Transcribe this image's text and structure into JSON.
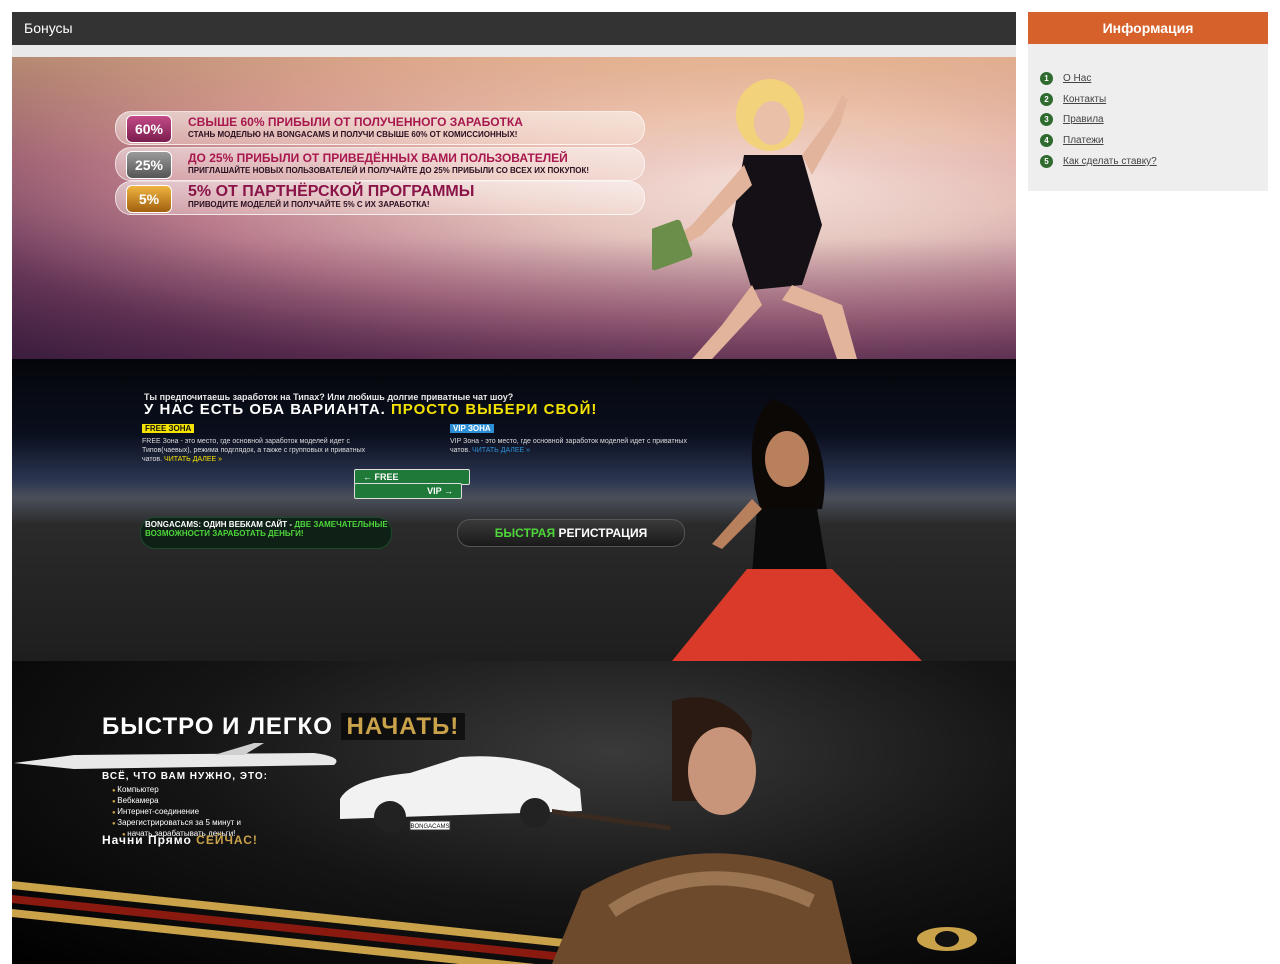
{
  "main": {
    "title": "Бонусы"
  },
  "banner1": {
    "rows": [
      {
        "badge": "60%",
        "title": "СВЫШЕ 60% ПРИБЫЛИ ОТ ПОЛУЧЕННОГО ЗАРАБОТКА",
        "sub": "СТАНЬ МОДЕЛЬЮ НА BONGACAMS И ПОЛУЧИ СВЫШЕ 60% ОТ КОМИССИОННЫХ!"
      },
      {
        "badge": "25%",
        "title": "ДО 25% ПРИБЫЛИ ОТ ПРИВЕДЁННЫХ ВАМИ ПОЛЬЗОВАТЕЛЕЙ",
        "sub": "ПРИГЛАШАЙТЕ НОВЫХ ПОЛЬЗОВАТЕЛЕЙ И ПОЛУЧАЙТЕ ДО 25% ПРИБЫЛИ СО ВСЕХ ИХ ПОКУПОК!"
      },
      {
        "badge": "5%",
        "title": "5% ОТ ПАРТНЁРСКОЙ ПРОГРАММЫ",
        "sub": "ПРИВОДИТЕ МОДЕЛЕЙ И ПОЛУЧАЙТЕ 5% С ИХ ЗАРАБОТКА!"
      }
    ]
  },
  "banner2": {
    "question": "Ты предпочитаешь заработок на Типах? Или любишь долгие приватные чат шоу?",
    "headline_part1": "У НАС ЕСТЬ ОБА ВАРИАНТА.",
    "headline_part2": "ПРОСТО ВЫБЕРИ СВОЙ!",
    "free_label": "FREE ЗОНА",
    "free_text": "FREE Зона - это место, где основной заработок моделей идет с Типов(чаевых), режима подглядок, а также с групповых и приватных чатов.",
    "free_link": "ЧИТАТЬ ДАЛЕЕ »",
    "vip_label": "VIP ЗОНА",
    "vip_text": "VIP Зона - это место, где основной заработок моделей идет с приватных чатов.",
    "vip_link": "ЧИТАТЬ ДАЛЕЕ »",
    "sign_free": "← FREE",
    "sign_vip": "VIP →",
    "slogan_white": "BONGACAMS: ОДИН ВЕБКАМ САЙТ -",
    "slogan_green": "ДВЕ ЗАМЕЧАТЕЛЬНЫЕ ВОЗМОЖНОСТИ ЗАРАБОТАТЬ ДЕНЬГИ!",
    "register_green": "БЫСТРАЯ",
    "register_white": "РЕГИСТРАЦИЯ"
  },
  "banner3": {
    "headline_white": "БЫСТРО И ЛЕГКО",
    "headline_gold": "НАЧАТЬ!",
    "need_title": "ВСЁ, ЧТО ВАМ НУЖНО, ЭТО:",
    "need_items": [
      "Компьютер",
      "Вебкамера",
      "Интернет-соединение",
      "Зарегистрироваться за 5 минут и",
      "начать зарабатывать деньги!"
    ],
    "cta_white": "Начни Прямо",
    "cta_gold": "СЕЙЧАС!",
    "plate": "BONGACAMS"
  },
  "sidebar": {
    "title": "Информация",
    "items": [
      {
        "num": "1",
        "label": "О Нас"
      },
      {
        "num": "2",
        "label": "Контакты"
      },
      {
        "num": "3",
        "label": "Правила"
      },
      {
        "num": "4",
        "label": "Платежи"
      },
      {
        "num": "5",
        "label": "Как сделать ставку?"
      }
    ]
  },
  "colors": {
    "header_bg": "#333333",
    "sidebar_accent": "#d7612b",
    "sidebar_bg": "#eeeeee",
    "number_badge": "#2f6b2f"
  }
}
